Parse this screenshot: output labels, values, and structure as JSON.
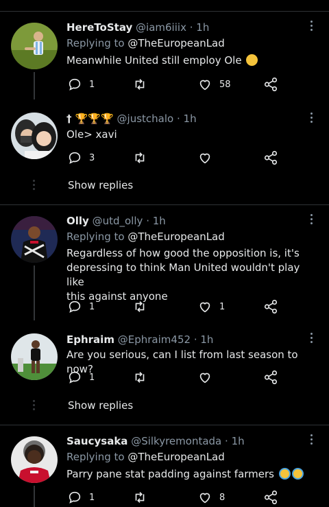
{
  "tweets": [
    {
      "name": "HereToStay",
      "handle": "@iam6iiix",
      "time": "· 1h",
      "replying_label": "Replying to",
      "replying_to": "@TheEuropeanLad",
      "text": "Meanwhile United still employ Ole",
      "emoji": "grinning-cat-emoji",
      "replies": "1",
      "retweets": "",
      "likes": "58"
    },
    {
      "name": "† 🏆🏆🏆",
      "handle": "@justchalo",
      "time": "· 1h",
      "text": "Ole> xavi",
      "replies": "3",
      "retweets": "",
      "likes": ""
    },
    {
      "name": "Olly",
      "handle": "@utd_olly",
      "time": "· 1h",
      "replying_label": "Replying to",
      "replying_to": "@TheEuropeanLad",
      "text_line1": "Regardless of how good the opposition is, it's",
      "text_line2": "depressing to think Man United wouldn't play like",
      "text_line3": "this against anyone",
      "replies": "1",
      "retweets": "",
      "likes": "1"
    },
    {
      "name": "Ephraim",
      "handle": "@Ephraim452",
      "time": "· 1h",
      "text": "Are you serious, can I list from last season to now?",
      "replies": "1",
      "retweets": "",
      "likes": ""
    },
    {
      "name": "Saucysaka",
      "handle": "@Silkyremontada",
      "time": "· 1h",
      "replying_label": "Replying to",
      "replying_to": "@TheEuropeanLad",
      "text": "Parry pane stat padding against farmers",
      "emoji": "crying-face-emoji",
      "replies": "1",
      "retweets": "",
      "likes": "8"
    }
  ],
  "show_replies_label": "Show replies",
  "colors": {
    "background": "#000000",
    "text": "#e7e9ea",
    "muted": "#8b98a5",
    "divider": "#2f3336"
  }
}
